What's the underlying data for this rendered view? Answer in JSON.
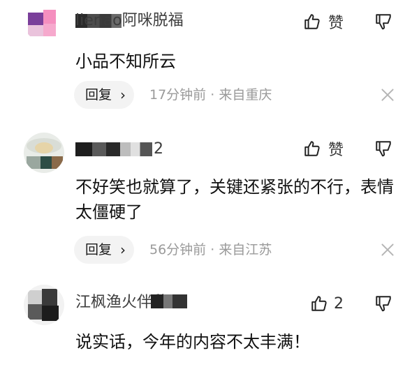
{
  "comments": [
    {
      "username": "lienao阿咪脱福",
      "like_label": "赞",
      "text": "小品不知所云",
      "reply_label": "回复",
      "time": "17分钟前",
      "location": "来自重庆",
      "separator": "·"
    },
    {
      "username": "2",
      "like_label": "赞",
      "text": "不好笑也就算了，关键还紧张的不行，表情太僵硬了",
      "reply_label": "回复",
      "time": "56分钟前",
      "location": "来自江苏",
      "separator": "·"
    },
    {
      "username": "江枫渔火伴愁眠",
      "like_label": "2",
      "text": "说实话，今年的内容不太丰满！"
    }
  ],
  "icons": {
    "like": "thumbs-up-icon",
    "dislike": "thumbs-down-icon",
    "close": "close-icon",
    "chevron": "chevron-right-icon"
  },
  "colors": {
    "meta_text": "#9a9a9a",
    "reply_bg": "#f3f3f3",
    "avatar1_pink": "#f58fbf",
    "avatar1_purple": "#7a3f9a"
  }
}
